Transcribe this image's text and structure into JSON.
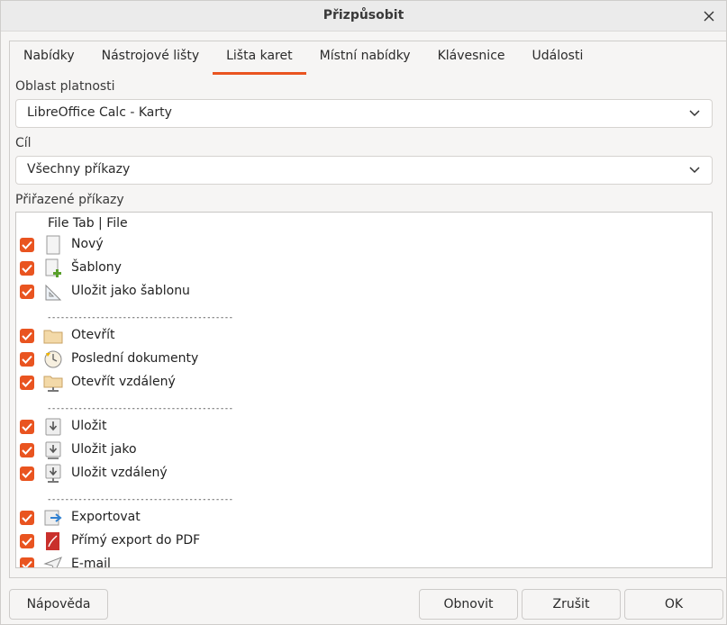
{
  "window": {
    "title": "Přizpůsobit"
  },
  "tabs": [
    {
      "label": "Nabídky",
      "active": false
    },
    {
      "label": "Nástrojové lišty",
      "active": false
    },
    {
      "label": "Lišta karet",
      "active": true
    },
    {
      "label": "Místní nabídky",
      "active": false
    },
    {
      "label": "Klávesnice",
      "active": false
    },
    {
      "label": "Události",
      "active": false
    }
  ],
  "scope": {
    "label": "Oblast platnosti",
    "value": "LibreOffice Calc - Karty"
  },
  "target": {
    "label": "Cíl",
    "value": "Všechny příkazy"
  },
  "assigned": {
    "label": "Přiřazené příkazy",
    "group_header": "File Tab | File",
    "separator": "------------------------------------------",
    "items": [
      {
        "kind": "item",
        "label": "Nový",
        "icon": "new-document-icon",
        "checked": true
      },
      {
        "kind": "item",
        "label": "Šablony",
        "icon": "templates-icon",
        "checked": true
      },
      {
        "kind": "item",
        "label": "Uložit jako šablonu",
        "icon": "save-as-template-icon",
        "checked": true
      },
      {
        "kind": "separator"
      },
      {
        "kind": "item",
        "label": "Otevřít",
        "icon": "folder-icon",
        "checked": true
      },
      {
        "kind": "item",
        "label": "Poslední dokumenty",
        "icon": "clock-icon",
        "checked": true
      },
      {
        "kind": "item",
        "label": "Otevřít vzdálený",
        "icon": "remote-folder-icon",
        "checked": true
      },
      {
        "kind": "separator"
      },
      {
        "kind": "item",
        "label": "Uložit",
        "icon": "save-icon",
        "checked": true
      },
      {
        "kind": "item",
        "label": "Uložit jako",
        "icon": "save-as-icon",
        "checked": true
      },
      {
        "kind": "item",
        "label": "Uložit vzdálený",
        "icon": "save-remote-icon",
        "checked": true
      },
      {
        "kind": "separator"
      },
      {
        "kind": "item",
        "label": "Exportovat",
        "icon": "export-icon",
        "checked": true
      },
      {
        "kind": "item",
        "label": "Přímý export do PDF",
        "icon": "pdf-icon",
        "checked": true
      },
      {
        "kind": "item",
        "label": "E-mail",
        "icon": "email-icon",
        "checked": true
      }
    ]
  },
  "buttons": {
    "help": "Nápověda",
    "reset": "Obnovit",
    "cancel": "Zrušit",
    "ok": "OK"
  },
  "colors": {
    "accent": "#e95420"
  }
}
